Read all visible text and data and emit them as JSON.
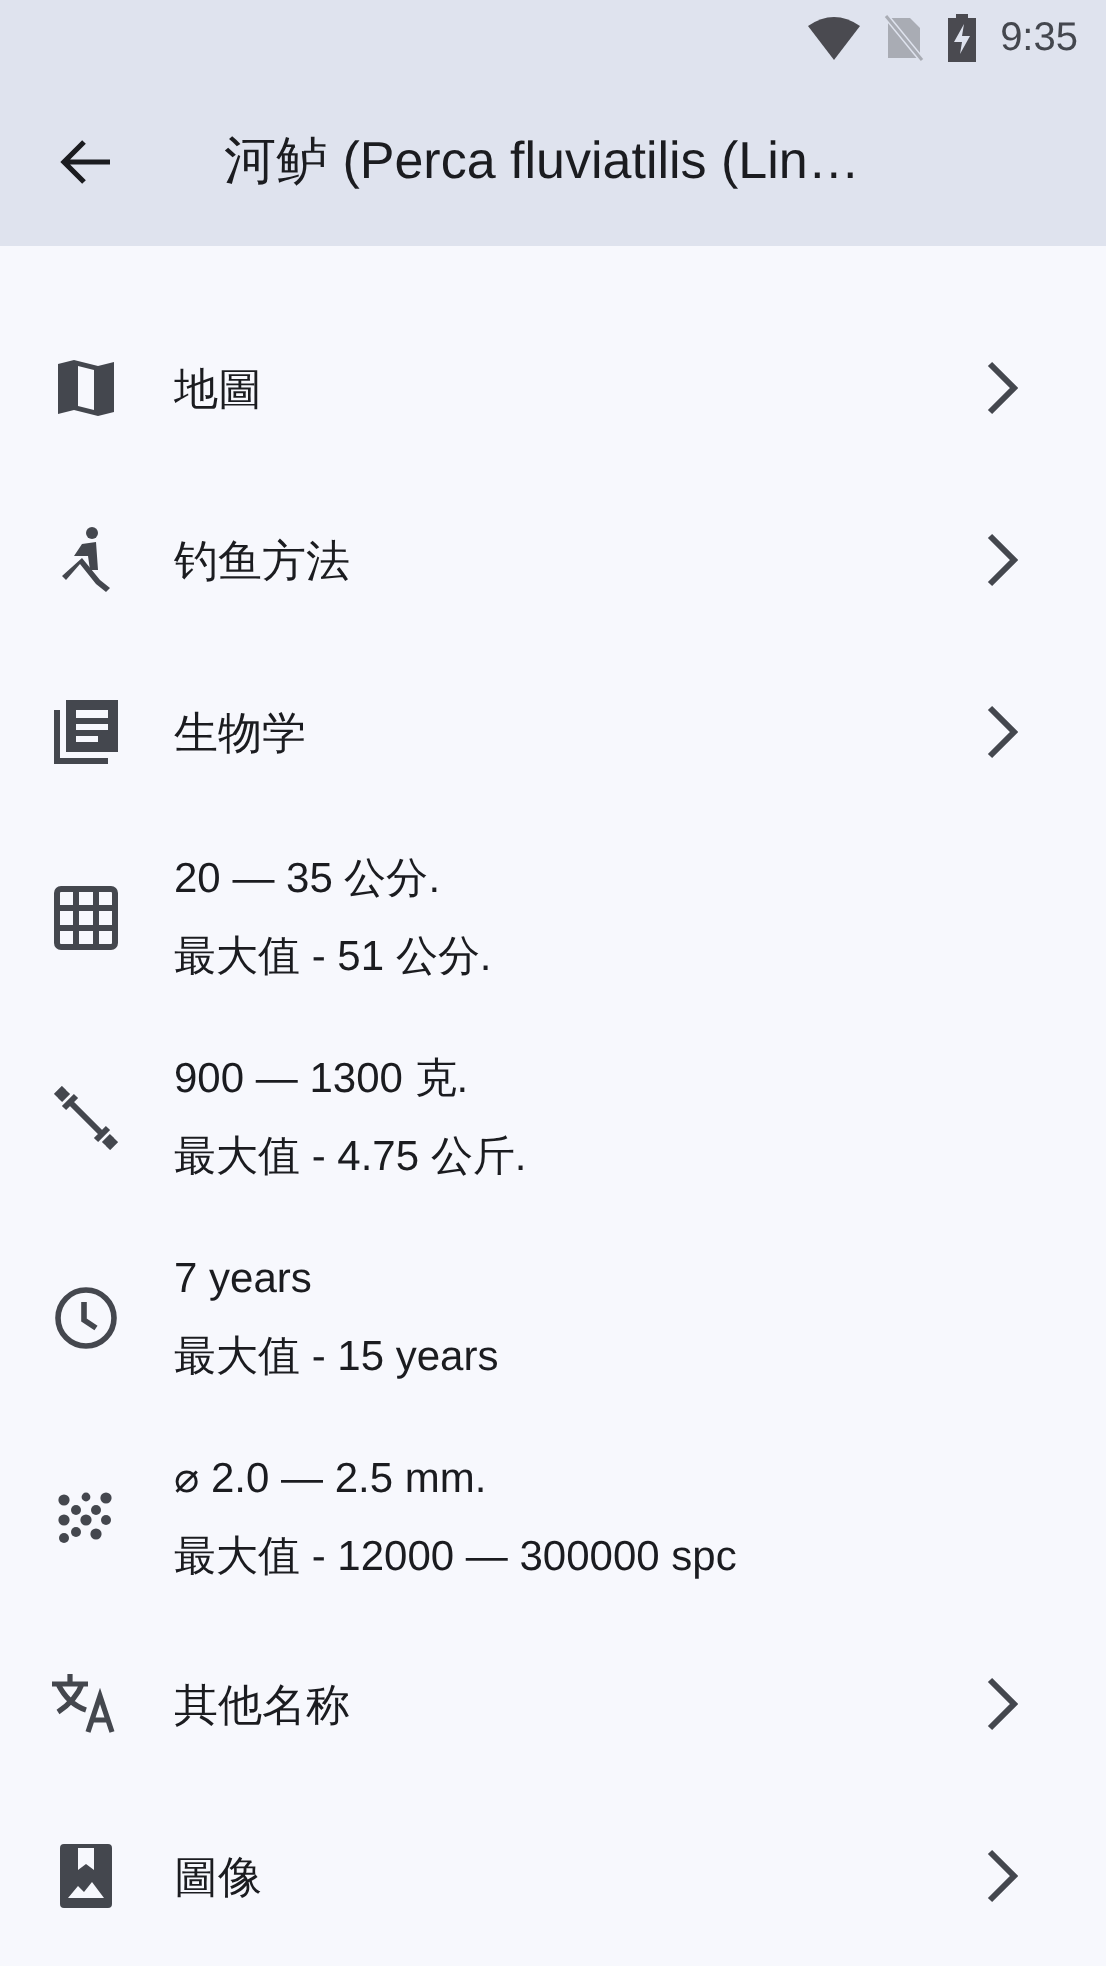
{
  "status_bar": {
    "time": "9:35"
  },
  "app_bar": {
    "title": "河鲈 (Perca fluviatilis (Lin…"
  },
  "items": [
    {
      "kind": "link",
      "label": "地圖"
    },
    {
      "kind": "link",
      "label": "钓鱼方法"
    },
    {
      "kind": "link",
      "label": "生物学"
    },
    {
      "kind": "info",
      "lines": [
        "20 — 35 公分.",
        "最大值 - 51 公分."
      ]
    },
    {
      "kind": "info",
      "lines": [
        "900 — 1300 克.",
        "最大值 - 4.75 公斤."
      ]
    },
    {
      "kind": "info",
      "lines": [
        "7 years",
        "最大值 - 15 years"
      ]
    },
    {
      "kind": "info",
      "lines": [
        "⌀ 2.0 — 2.5 mm.",
        "最大值 - 12000 — 300000 spc"
      ]
    },
    {
      "kind": "link",
      "label": "其他名称"
    },
    {
      "kind": "link",
      "label": "圖像"
    }
  ]
}
